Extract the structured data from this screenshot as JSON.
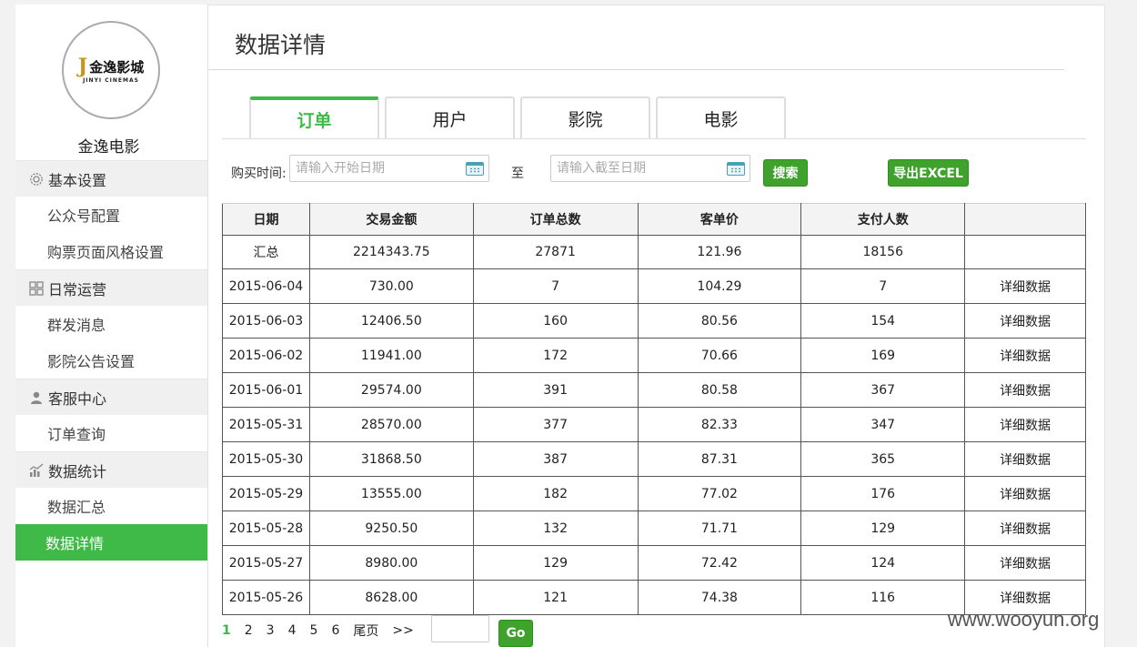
{
  "brand": {
    "logo_cn": "金逸影城",
    "logo_en": "JINYI CINEMAS",
    "name": "金逸电影"
  },
  "sidebar": {
    "groups": [
      {
        "label": "基本设置",
        "icon": "gear-icon",
        "items": [
          "公众号配置",
          "购票页面风格设置"
        ]
      },
      {
        "label": "日常运营",
        "icon": "grid-icon",
        "items": [
          "群发消息",
          "影院公告设置"
        ]
      },
      {
        "label": "客服中心",
        "icon": "user-icon",
        "items": [
          "订单查询"
        ]
      },
      {
        "label": "数据统计",
        "icon": "chart-icon",
        "items": [
          "数据汇总",
          "数据详情"
        ]
      }
    ],
    "active_item": "数据详情"
  },
  "page": {
    "title": "数据详情"
  },
  "tabs": [
    {
      "label": "订单",
      "active": true
    },
    {
      "label": "用户",
      "active": false
    },
    {
      "label": "影院",
      "active": false
    },
    {
      "label": "电影",
      "active": false
    }
  ],
  "filter": {
    "label": "购买时间:",
    "start_placeholder": "请输入开始日期",
    "to_label": "至",
    "end_placeholder": "请输入截至日期",
    "search_label": "搜索",
    "export_label": "导出EXCEL"
  },
  "table": {
    "headers": [
      "日期",
      "交易金额",
      "订单总数",
      "客单价",
      "支付人数",
      ""
    ],
    "summary": [
      "汇总",
      "2214343.75",
      "27871",
      "121.96",
      "18156",
      ""
    ],
    "rows": [
      [
        "2015-06-04",
        "730.00",
        "7",
        "104.29",
        "7",
        "详细数据"
      ],
      [
        "2015-06-03",
        "12406.50",
        "160",
        "80.56",
        "154",
        "详细数据"
      ],
      [
        "2015-06-02",
        "11941.00",
        "172",
        "70.66",
        "169",
        "详细数据"
      ],
      [
        "2015-06-01",
        "29574.00",
        "391",
        "80.58",
        "367",
        "详细数据"
      ],
      [
        "2015-05-31",
        "28570.00",
        "377",
        "82.33",
        "347",
        "详细数据"
      ],
      [
        "2015-05-30",
        "31868.50",
        "387",
        "87.31",
        "365",
        "详细数据"
      ],
      [
        "2015-05-29",
        "13555.00",
        "182",
        "77.02",
        "176",
        "详细数据"
      ],
      [
        "2015-05-28",
        "9250.50",
        "132",
        "71.71",
        "129",
        "详细数据"
      ],
      [
        "2015-05-27",
        "8980.00",
        "129",
        "72.42",
        "124",
        "详细数据"
      ],
      [
        "2015-05-26",
        "8628.00",
        "121",
        "74.38",
        "116",
        "详细数据"
      ]
    ]
  },
  "pager": {
    "pages": [
      "1",
      "2",
      "3",
      "4",
      "5",
      "6"
    ],
    "current": "1",
    "last_label": "尾页",
    "next_label": ">>",
    "go_label": "Go"
  },
  "watermark": "www.wooyun.org",
  "colors": {
    "accent": "#3fba48",
    "button": "#3fa22c"
  }
}
